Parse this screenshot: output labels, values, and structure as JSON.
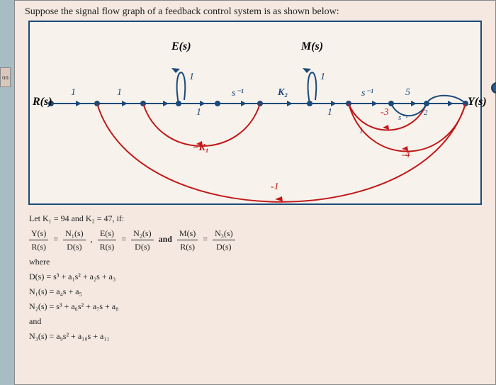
{
  "tab_label": "on",
  "problem_text": "Suppose the signal flow graph of a feedback control system is as shown below:",
  "diagram": {
    "input_label": "R(s)",
    "output_label": "Y(s)",
    "top_E": "E(s)",
    "top_M": "M(s)",
    "edges": {
      "g1": "1",
      "g2": "1",
      "g3_selfE": "1",
      "g4_after_E": "1",
      "g5": "s⁻¹",
      "g6": "K₂",
      "g7_selfM": "1",
      "g8_after_M": "1",
      "g9": "s⁻¹",
      "g10": "5",
      "minusK1": "−K₁",
      "minus1_long": "-1",
      "minus3": "-3",
      "inner_s": "s⁻¹",
      "inner_2": "2",
      "inner_1": "1",
      "minus4": "-4"
    }
  },
  "lower": {
    "line1_prefix": "Let K₁ = 94 and K₂ = 47, if:",
    "frac1_num": "Y(s)",
    "frac1_den": "R(s)",
    "frac2_num": "N₁(s)",
    "frac2_den": "D(s)",
    "frac3_num": "E(s)",
    "frac3_den": "R(s)",
    "frac4_num": "N₂(s)",
    "frac4_den": "D(s)",
    "and_word": "and",
    "frac5_num": "M(s)",
    "frac5_den": "R(s)",
    "frac6_num": "N₃(s)",
    "frac6_den": "D(s)",
    "where": "where",
    "Ds": "D(s) = s³ + a₁s² + a₂s + a₃",
    "N1s": "N₁(s) = a₄s + a₅",
    "N2s": "N₂(s) = s³ + a₆s² + a₇s + a₈",
    "and2": "and",
    "N3s": "N₃(s) = a₉s² + a₁₀s + a₁₁"
  }
}
